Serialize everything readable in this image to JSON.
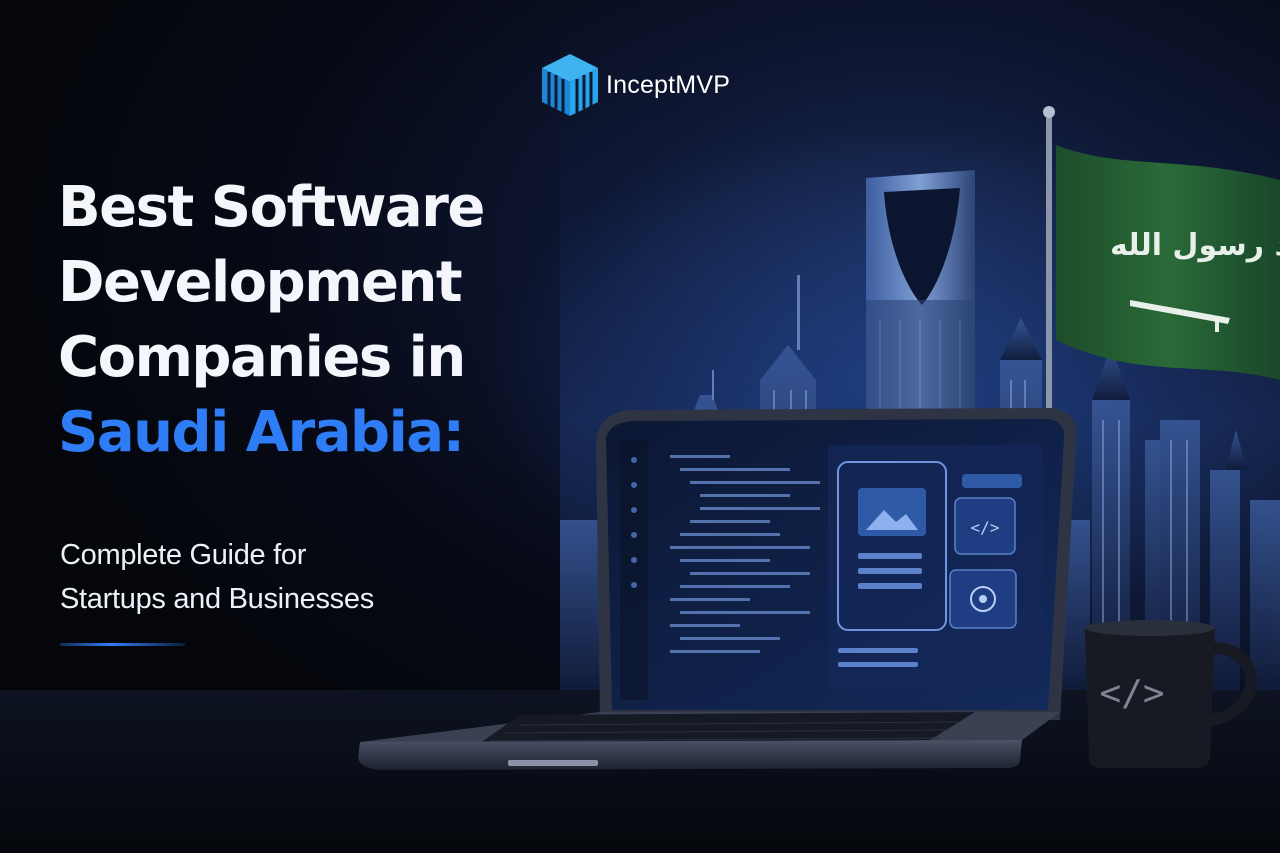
{
  "brand": {
    "name": "InceptMVP",
    "accent_color": "#2f7df6",
    "logo_icon": "isometric-cube-logo"
  },
  "headline": {
    "line1": "Best Software",
    "line2": "Development",
    "line3": "Companies in",
    "line4_highlight": "Saudi Arabia:"
  },
  "subtitle": {
    "line1": "Complete Guide for",
    "line2": "Startups and Businesses"
  },
  "hero_image": {
    "elements": [
      "kingdom-tower",
      "city-skyline",
      "saudi-flag",
      "laptop",
      "coffee-mug"
    ],
    "flag_color": "#1f5a2e",
    "flag_script": "لا إله إلا الله محمد رسول الله",
    "mug_glyph": "</>",
    "screen_card_glyph": "</>"
  }
}
